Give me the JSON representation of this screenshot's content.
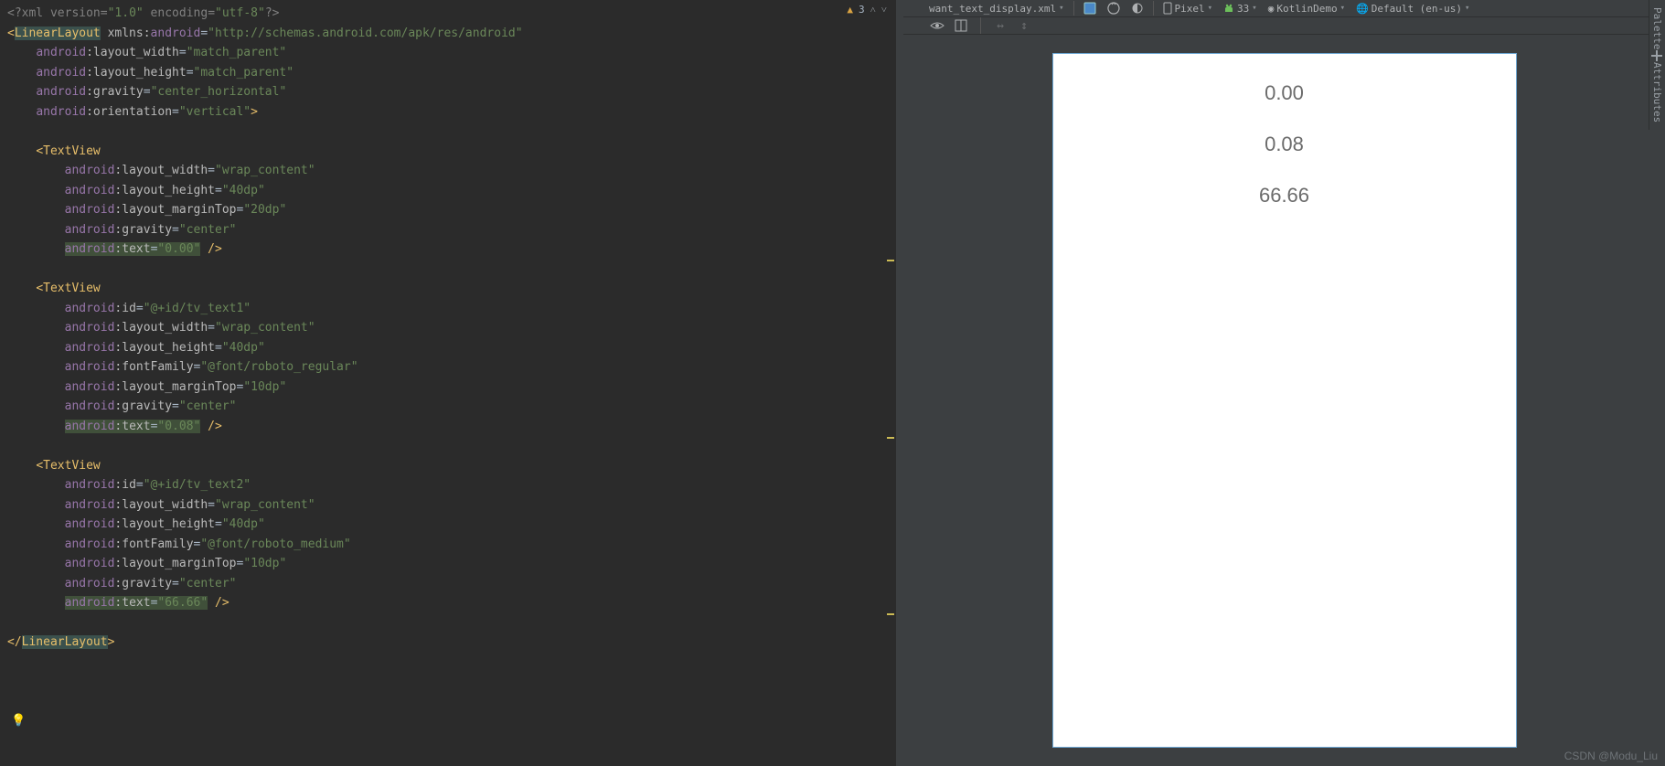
{
  "status": {
    "warning_count": "3"
  },
  "toolbar": {
    "file": "want_text_display.xml",
    "device": "Pixel",
    "api": "33",
    "theme": "KotlinDemo",
    "locale": "Default (en-us)"
  },
  "preview": {
    "tv1": "0.00",
    "tv2": "0.08",
    "tv3": "66.66"
  },
  "side": {
    "palette": "Palette",
    "attributes": "Attributes"
  },
  "watermark": "CSDN @Modu_Liu",
  "code": {
    "l1_a": "<?xml ",
    "l1_b": "version",
    "l1_c": "=",
    "l1_d": "\"1.0\"",
    "l1_e": " encoding",
    "l1_f": "=",
    "l1_g": "\"utf-8\"",
    "l1_h": "?>",
    "l2_a": "<",
    "l2_b": "LinearLayout",
    "l2_c": " xmlns:",
    "l2_d": "android",
    "l2_e": "=",
    "l2_f": "\"http://schemas.android.com/apk/res/android\"",
    "l3_ns": "android",
    "l3_n": ":layout_width",
    "l3_e": "=",
    "l3_v": "\"match_parent\"",
    "l4_ns": "android",
    "l4_n": ":layout_height",
    "l4_e": "=",
    "l4_v": "\"match_parent\"",
    "l5_ns": "android",
    "l5_n": ":gravity",
    "l5_e": "=",
    "l5_v": "\"center_horizontal\"",
    "l6_ns": "android",
    "l6_n": ":orientation",
    "l6_e": "=",
    "l6_v": "\"vertical\"",
    "l6_c": ">",
    "tv_open": "<TextView",
    "aw_ns": "android",
    "aw_n": ":layout_width",
    "aw_e": "=",
    "aw_v": "\"wrap_content\"",
    "ah_ns": "android",
    "ah_n": ":layout_height",
    "ah_e": "=",
    "ah_v": "\"40dp\"",
    "amt20_ns": "android",
    "amt20_n": ":layout_marginTop",
    "amt20_e": "=",
    "amt20_v": "\"20dp\"",
    "amt10_ns": "android",
    "amt10_n": ":layout_marginTop",
    "amt10_e": "=",
    "amt10_v": "\"10dp\"",
    "ag_ns": "android",
    "ag_n": ":gravity",
    "ag_e": "=",
    "ag_v": "\"center\"",
    "aid1_ns": "android",
    "aid1_n": ":id",
    "aid1_e": "=",
    "aid1_v": "\"@+id/tv_text1\"",
    "aid2_ns": "android",
    "aid2_n": ":id",
    "aid2_e": "=",
    "aid2_v": "\"@+id/tv_text2\"",
    "aff1_ns": "android",
    "aff1_n": ":fontFamily",
    "aff1_e": "=",
    "aff1_v": "\"@font/roboto_regular\"",
    "aff2_ns": "android",
    "aff2_n": ":fontFamily",
    "aff2_e": "=",
    "aff2_v": "\"@font/roboto_medium\"",
    "at_ns": "android",
    "at_n": ":text",
    "at1_v": "\"0.00\"",
    "at2_v": "\"0.08\"",
    "at3_v": "\"66.66\"",
    "close_self": " />",
    "close_root_a": "</",
    "close_root_b": "LinearLayout",
    "close_root_c": ">"
  }
}
